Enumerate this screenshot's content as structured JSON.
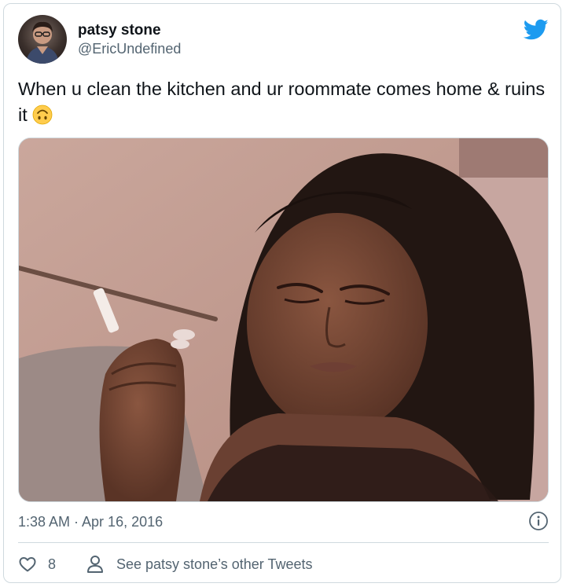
{
  "user": {
    "display_name": "patsy stone",
    "handle": "@EricUndefined",
    "avatar_icon": "user-avatar"
  },
  "tweet": {
    "text": "When u clean the kitchen and ur roommate comes home & ruins it",
    "emoji": "upside-down-face",
    "media_alt": "photo-woman-smoking",
    "timestamp": "1:38 AM · Apr 16, 2016"
  },
  "actions": {
    "like_count": "8",
    "other_tweets_label": "See patsy stone’s other Tweets"
  },
  "icons": {
    "brand": "twitter-bird-icon",
    "info": "info-icon",
    "like": "heart-icon",
    "profile": "person-icon"
  },
  "colors": {
    "brand_blue": "#1d9bf0",
    "text_primary": "#0f1419",
    "text_secondary": "#536471",
    "border": "#cfd9de"
  }
}
